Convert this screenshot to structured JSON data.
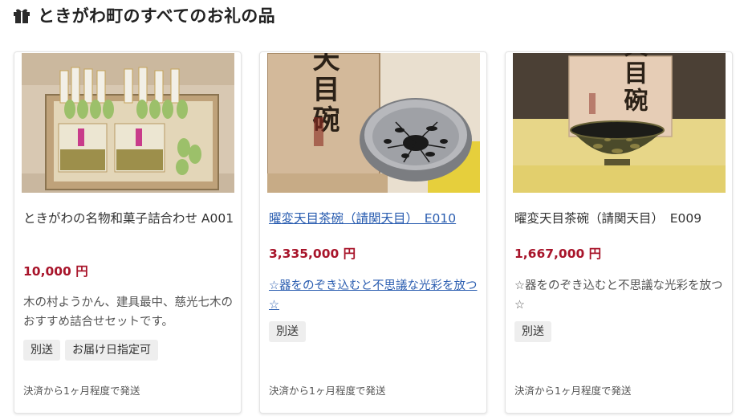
{
  "header": {
    "title": "ときがわ町のすべてのお礼の品",
    "icon": "gift-icon"
  },
  "products": [
    {
      "title": "ときがわの名物和菓子詰合わせ A001",
      "price": "10,000 円",
      "description": "木の村ようかん、建具最中、慈光七木のおすすめ詰合せセットです。",
      "tags": [
        "別送",
        "お届け日指定可"
      ],
      "footer": "決済から1ヶ月程度で発送",
      "favorite_icon": "heart-icon"
    },
    {
      "title": "曜変天目茶碗（請関天目）　E010",
      "price": "3,335,000 円",
      "description": "☆器をのぞき込むと不思議な光彩を放つ☆",
      "tags": [
        "別送"
      ],
      "footer": "決済から1ヶ月程度で発送",
      "favorite_icon": "heart-icon"
    },
    {
      "title": "曜変天目茶碗（請関天目）　E009",
      "price": "1,667,000 円",
      "description": "☆器をのぞき込むと不思議な光彩を放つ☆",
      "tags": [
        "別送"
      ],
      "footer": "決済から1ヶ月程度で発送",
      "favorite_icon": "heart-icon"
    }
  ],
  "image_text": {
    "box_label": "天目碗"
  },
  "colors": {
    "price": "#a8142a",
    "link": "#2a5db0",
    "tag_bg": "#eeeeee"
  }
}
